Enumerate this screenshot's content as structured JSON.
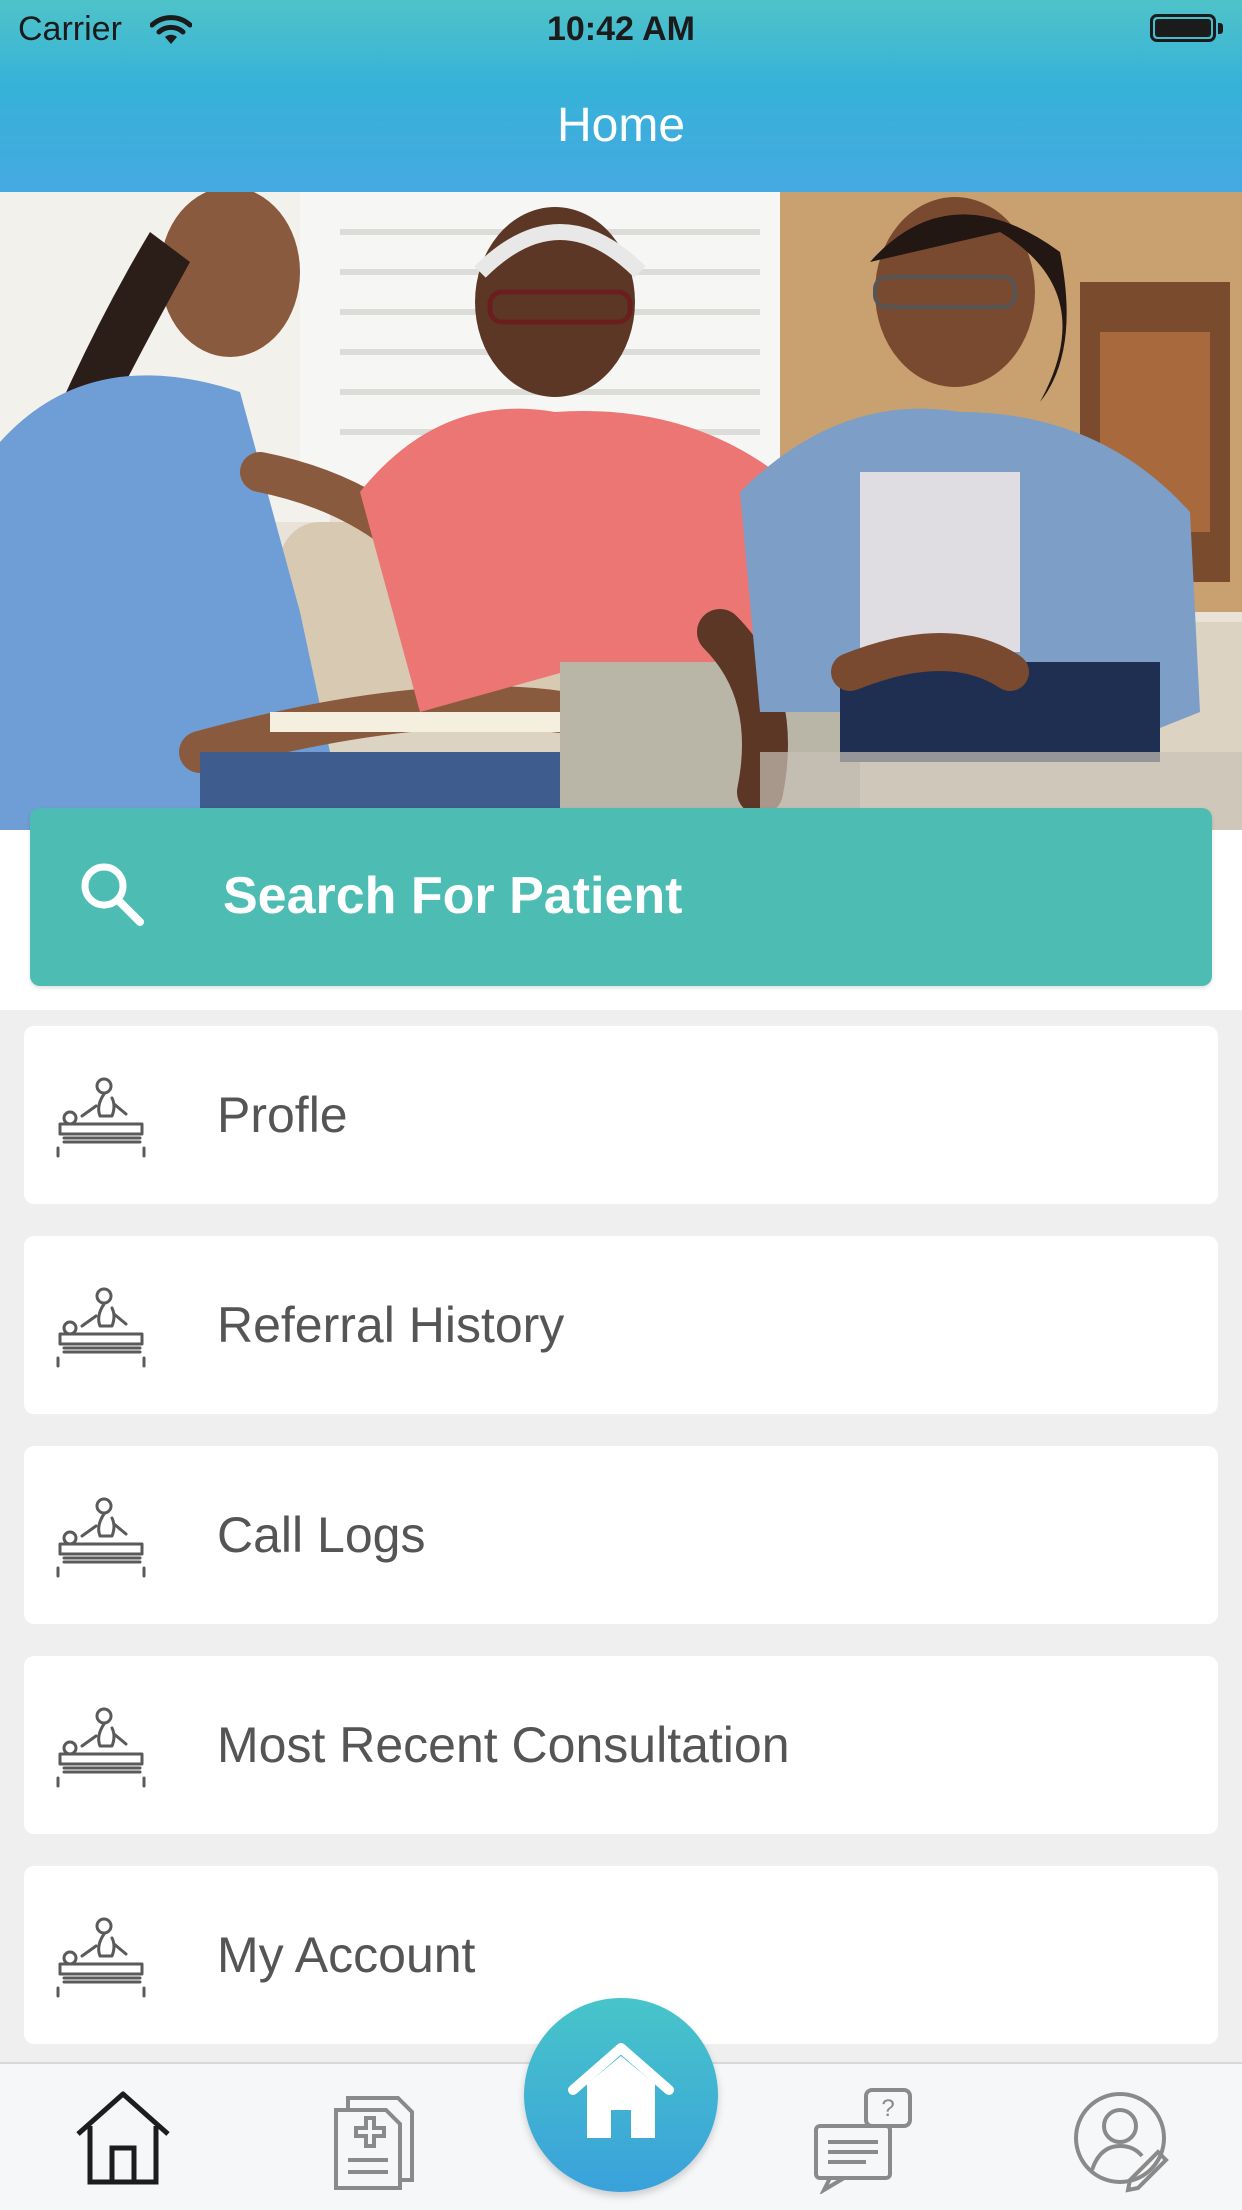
{
  "status_bar": {
    "carrier": "Carrier",
    "time": "10:42 AM"
  },
  "header": {
    "title": "Home"
  },
  "hero": {
    "icon": "hero-photo-caregivers"
  },
  "search": {
    "label": "Search For Patient",
    "icon": "search-icon"
  },
  "menu": {
    "items": [
      {
        "label": "Profle",
        "icon": "massage-therapy-icon"
      },
      {
        "label": "Referral History",
        "icon": "massage-therapy-icon"
      },
      {
        "label": "Call Logs",
        "icon": "massage-therapy-icon"
      },
      {
        "label": "Most Recent Consultation",
        "icon": "massage-therapy-icon"
      },
      {
        "label": "My Account",
        "icon": "massage-therapy-icon"
      }
    ]
  },
  "tabbar": {
    "items": [
      "home-outline-icon",
      "medical-document-icon",
      "home-filled-icon",
      "chat-help-icon",
      "user-edit-icon"
    ],
    "active": "home-filled-icon"
  },
  "colors": {
    "header_top": "#4fc3c9",
    "header_bottom": "#46a9e2",
    "search_bg": "#4dbdb3",
    "page_bg": "#efefef"
  }
}
